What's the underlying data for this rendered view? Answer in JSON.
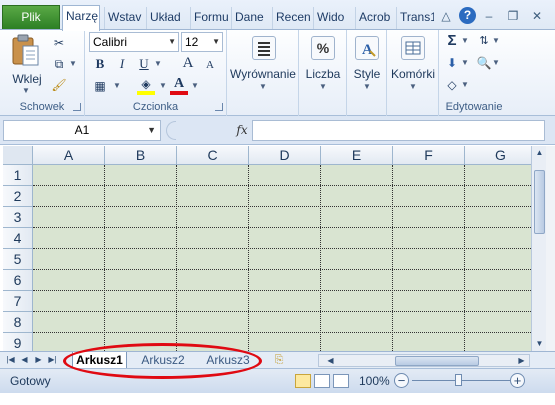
{
  "tabs": {
    "file": "Plik",
    "items": [
      "Narzę",
      "Wstav",
      "Układ",
      "Formu",
      "Dane",
      "Recen",
      "Wido",
      "Acrob",
      "Trans1"
    ]
  },
  "ribbon": {
    "clipboard": {
      "label": "Schowek",
      "paste": "Wklej"
    },
    "font": {
      "label": "Czcionka",
      "name": "Calibri",
      "size": "12",
      "bold": "B",
      "italic": "I",
      "underline": "U",
      "grow": "A",
      "shrink": "A",
      "color_letter": "A"
    },
    "alignment": {
      "label": "Wyrównanie"
    },
    "number": {
      "label": "Liczba",
      "symbol": "%"
    },
    "styles": {
      "label": "Style"
    },
    "cells": {
      "label": "Komórki"
    },
    "editing": {
      "label": "Edytowanie",
      "sigma": "Σ"
    }
  },
  "formula_bar": {
    "name_box": "A1",
    "fx": "fx",
    "value": ""
  },
  "grid": {
    "columns": [
      "A",
      "B",
      "C",
      "D",
      "E",
      "F",
      "G"
    ],
    "rows": [
      "1",
      "2",
      "3",
      "4",
      "5",
      "6",
      "7",
      "8",
      "9"
    ]
  },
  "sheets": [
    {
      "name": "Arkusz1",
      "active": true
    },
    {
      "name": "Arkusz2",
      "active": false
    },
    {
      "name": "Arkusz3",
      "active": false
    }
  ],
  "status": {
    "ready": "Gotowy",
    "zoom": "100%"
  },
  "colors": {
    "file_tab": "#3a8f2c",
    "cell_fill": "#d9e4d1",
    "annotation": "#e00a12",
    "accent": "#1e395b"
  }
}
